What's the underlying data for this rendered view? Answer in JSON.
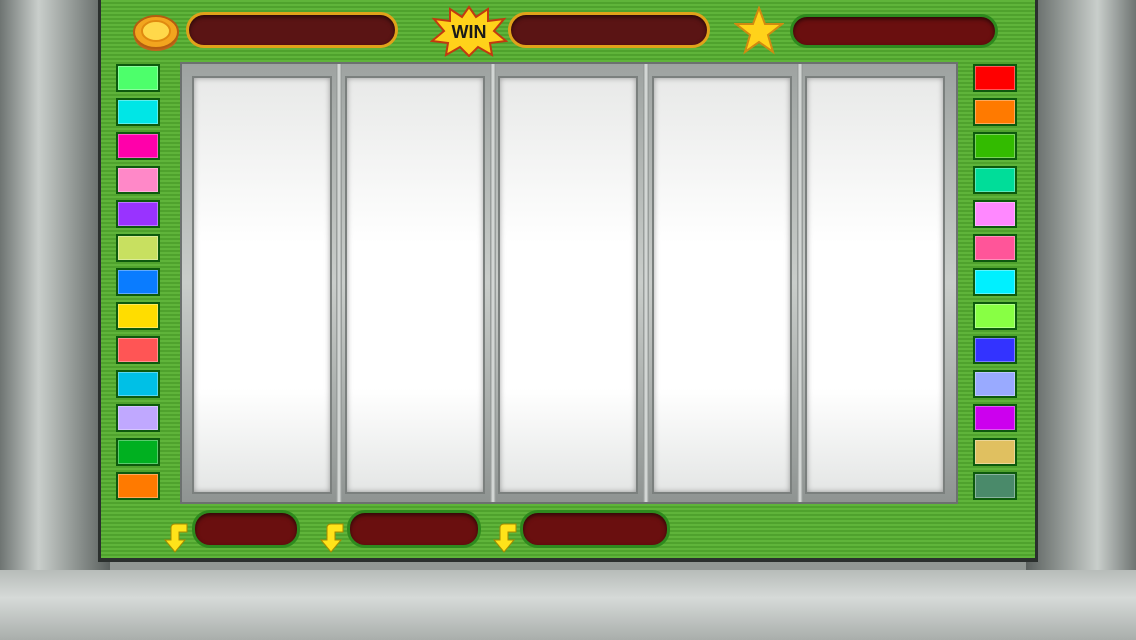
{
  "game": {
    "title": "",
    "win_label": "WIN"
  },
  "top": {
    "credits_value": "",
    "win_value": "",
    "bonus_value": ""
  },
  "icons": {
    "coin": "coin-icon",
    "win": "win-burst-icon",
    "star": "star-icon",
    "arrow": "bet-arrow-icon"
  },
  "colors": {
    "panel": "#55aa33",
    "display_bg": "#5a1414",
    "gold_border": "#e0a21a",
    "green_border": "#2e8a1e"
  },
  "paylines_left": [
    "#4dff6b",
    "#00e6e6",
    "#ff00aa",
    "#ff88c8",
    "#9933ff",
    "#c8e060",
    "#0a7cff",
    "#ffdd00",
    "#ff5555",
    "#00c0e6",
    "#c0a8ff",
    "#00b020",
    "#ff7a00"
  ],
  "paylines_right": [
    "#ff0000",
    "#ff7a00",
    "#33bb00",
    "#00dd99",
    "#ff88ff",
    "#ff5599",
    "#00f0ff",
    "#88ff44",
    "#3333ff",
    "#99aaff",
    "#cc00ee",
    "#e0c060",
    "#4a8a6a"
  ],
  "reels": [
    "",
    "",
    "",
    "",
    ""
  ],
  "bottom": {
    "lines_value": "",
    "bet_value": "",
    "total_bet_value": ""
  }
}
